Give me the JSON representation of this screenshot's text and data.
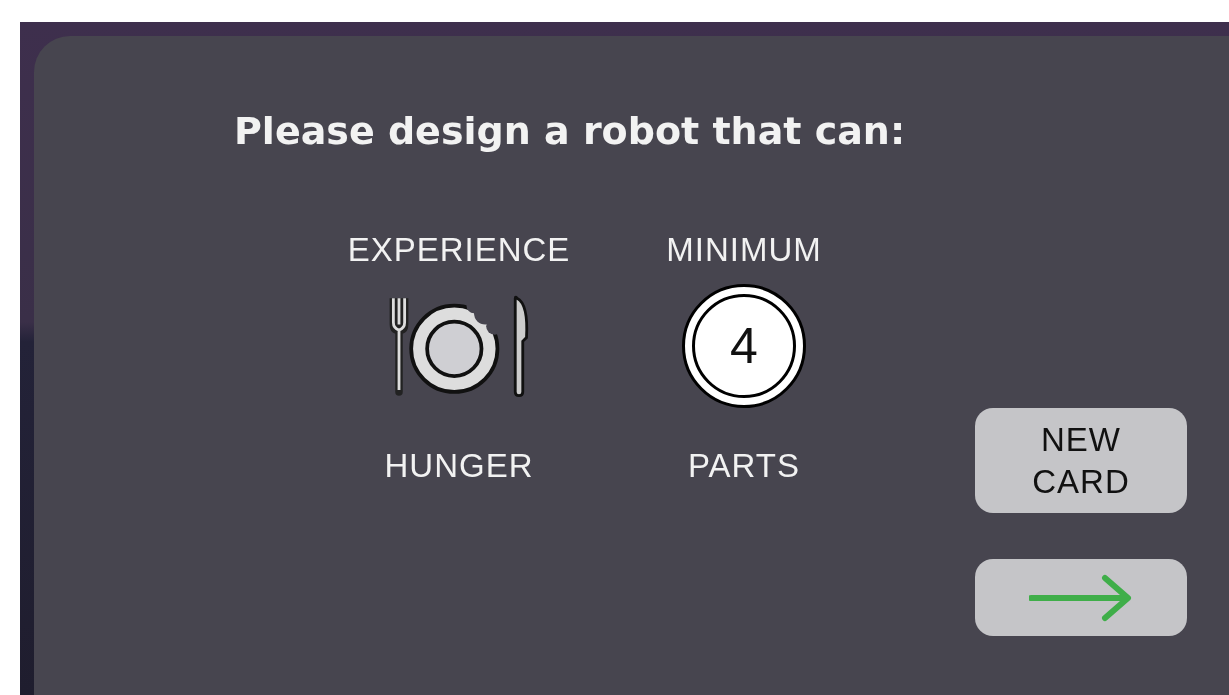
{
  "title": "Please design a robot that can:",
  "requirements": [
    {
      "kind": "hunger",
      "top_label": "EXPERIENCE",
      "bottom_label": "HUNGER"
    },
    {
      "kind": "number",
      "top_label": "MINIMUM",
      "number": "4",
      "bottom_label": "PARTS"
    }
  ],
  "buttons": [
    {
      "kind": "text",
      "label": "NEW CARD"
    },
    {
      "kind": "arrow"
    }
  ]
}
